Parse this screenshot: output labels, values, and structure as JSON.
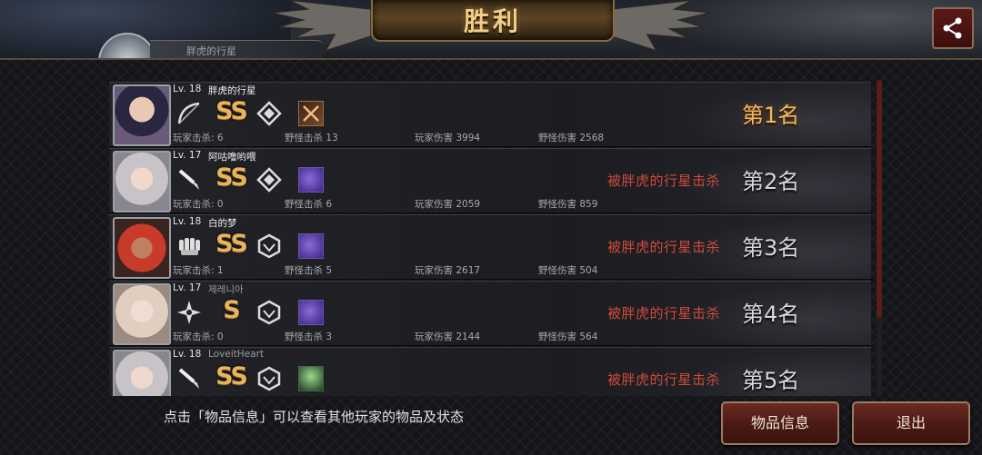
{
  "title": "胜利",
  "header_tab_text": "胖虎的行星",
  "players": [
    {
      "level": "Lv. 18",
      "name": "胖虎的行星",
      "grade": "SS",
      "killed_by": "",
      "rank": "第1名",
      "player_kills_label": "玩家击杀: 6",
      "monster_kills_label": "野怪击杀 13",
      "player_damage_label": "玩家伤害 3994",
      "monster_damage_label": "野怪伤害 2568",
      "weapon_icon": "bow-icon",
      "role_icon": "diamond-emblem-icon",
      "item_icon": "crossed-blades-item-icon"
    },
    {
      "level": "Lv. 17",
      "name": "阿咕噜哟喂",
      "grade": "SS",
      "killed_by": "被胖虎的行星击杀",
      "rank": "第2名",
      "player_kills_label": "玩家击杀: 0",
      "monster_kills_label": "野怪击杀 6",
      "player_damage_label": "玩家伤害 2059",
      "monster_damage_label": "野怪伤害 859",
      "weapon_icon": "knife-icon",
      "role_icon": "diamond-emblem-icon",
      "item_icon": "purple-beast-item-icon"
    },
    {
      "level": "Lv. 18",
      "name": "白的梦",
      "grade": "SS",
      "killed_by": "被胖虎的行星击杀",
      "rank": "第3名",
      "player_kills_label": "玩家击杀: 1",
      "monster_kills_label": "野怪击杀 5",
      "player_damage_label": "玩家伤害 2617",
      "monster_damage_label": "野怪伤害 504",
      "weapon_icon": "fist-icon",
      "role_icon": "hexagon-emblem-icon",
      "item_icon": "purple-beast-item-icon"
    },
    {
      "level": "Lv. 17",
      "name": "제레니아",
      "grade": "S",
      "killed_by": "被胖虎的行星击杀",
      "rank": "第4名",
      "player_kills_label": "玩家击杀: 0",
      "monster_kills_label": "野怪击杀 3",
      "player_damage_label": "玩家伤害 2144",
      "monster_damage_label": "野怪伤害 564",
      "weapon_icon": "shuriken-icon",
      "role_icon": "hexagon-emblem-icon",
      "item_icon": "purple-beast-item-icon"
    },
    {
      "level": "Lv. 18",
      "name": "LoveitHeart",
      "grade": "SS",
      "killed_by": "被胖虎的行星击杀",
      "rank": "第5名",
      "player_kills_label": "",
      "monster_kills_label": "",
      "player_damage_label": "",
      "monster_damage_label": "",
      "weapon_icon": "knife-icon",
      "role_icon": "hexagon-emblem-icon",
      "item_icon": "green-creature-item-icon"
    }
  ],
  "hint_text": "点击「物品信息」可以查看其他玩家的物品及状态",
  "buttons": {
    "items_label": "物品信息",
    "exit_label": "退出"
  },
  "colors": {
    "gold": "#e8b45a",
    "kill_red": "#d14a3a",
    "button_red": "#4a1a15"
  }
}
